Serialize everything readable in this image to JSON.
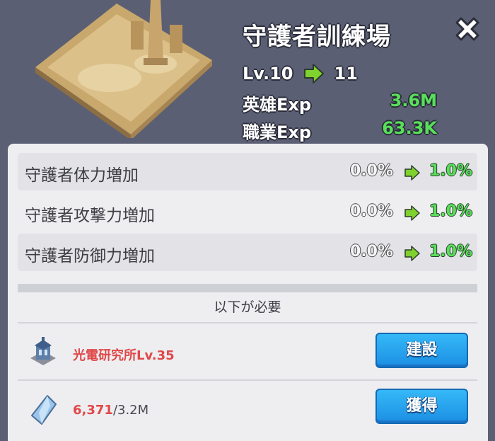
{
  "header": {
    "title": "守護者訓練場",
    "level_from": "Lv.10",
    "level_to": "11",
    "exp": [
      {
        "label": "英雄Exp",
        "value": "3.6M"
      },
      {
        "label": "職業Exp",
        "value": "63.3K"
      }
    ]
  },
  "stats": [
    {
      "name": "守護者体力増加",
      "current": "0.0%",
      "next": "1.0%"
    },
    {
      "name": "守護者攻撃力増加",
      "current": "0.0%",
      "next": "1.0%"
    },
    {
      "name": "守護者防御力増加",
      "current": "0.0%",
      "next": "1.0%"
    }
  ],
  "requirements": {
    "title": "以下が必要",
    "items": [
      {
        "label": "光電研究所Lv.35",
        "button": "建設",
        "icon": "laboratory-building-icon"
      },
      {
        "label_have": "6,371",
        "label_need": "/3.2M",
        "button": "獲得",
        "icon": "crystal-icon"
      }
    ]
  },
  "colors": {
    "background": "#5b5f74",
    "panel": "#eeeef1",
    "green": "#58e05a",
    "red": "#e04848",
    "button": "#1c8fe3"
  }
}
